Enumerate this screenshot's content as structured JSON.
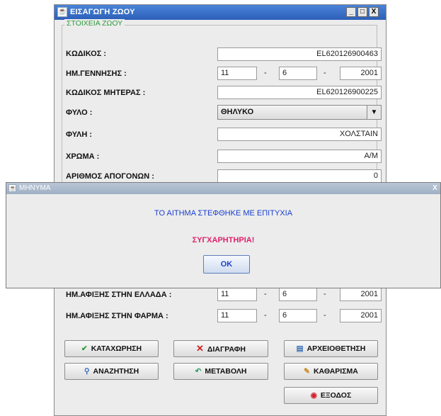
{
  "main_window": {
    "title": "ΕΙΣΑΓΩΓΗ ΖΩΟΥ",
    "window_buttons": [
      "_",
      "□",
      "X"
    ],
    "legend": "ΣΤΟΙΧΕΙΑ ΖΩΟΥ",
    "fields": {
      "code_label": "ΚΩΔΙΚΟΣ :",
      "code_value": "EL620126900463",
      "birth_label": "ΗΜ.ΓΕΝΝΗΣΗΣ :",
      "birth_day": "11",
      "birth_month": "6",
      "birth_year": "2001",
      "mother_label": "ΚΩΔΙΚΟΣ ΜΗΤΕΡΑΣ :",
      "mother_value": "EL620126900225",
      "sex_label": "ΦΥΛΟ :",
      "sex_value": "ΘΗΛΥΚΟ",
      "breed_label": "ΦΥΛΗ :",
      "breed_value": "ΧΟΛΣΤΑΙΝ",
      "color_label": "ΧΡΩΜΑ :",
      "color_value": "Α/Μ",
      "offspring_label": "ΑΡΙΘΜΟΣ ΑΠΟΓΟΝΩΝ :",
      "offspring_value": "0",
      "arrival_gr_label": "ΗΜ.ΑΦΙΞΗΣ ΣΤΗΝ ΕΛΛΑΔΑ :",
      "arrival_gr_day": "11",
      "arrival_gr_month": "6",
      "arrival_gr_year": "2001",
      "arrival_farm_label": "ΗΜ.ΑΦΙΞΗΣ ΣΤΗΝ ΦΑΡΜΑ :",
      "arrival_farm_day": "11",
      "arrival_farm_month": "6",
      "arrival_farm_year": "2001",
      "dash": "-"
    },
    "buttons": {
      "register": "ΚΑΤΑΧΩΡΗΣΗ",
      "delete": "ΔΙΑΓΡΑΦΗ",
      "archive": "ΑΡΧΕΙΟΘΕΤΗΣΗ",
      "search": "ΑΝΑΖΗΤΗΣΗ",
      "modify": "ΜΕΤΑΒΟΛΗ",
      "clear": "ΚΑΘΑΡΙΣΜΑ",
      "exit": "ΕΞΟΔΟΣ"
    },
    "icons": {
      "register": "checkmark-icon",
      "delete": "x-icon",
      "archive": "folder-icon",
      "search": "magnifier-icon",
      "modify": "undo-arrow-icon",
      "clear": "broom-icon",
      "exit": "exit-icon"
    }
  },
  "dialog": {
    "title": "ΜΗΝΥΜΑ",
    "message_line1": "ΤΟ ΑΙΤΗΜΑ ΣΤΕΦΘΗΚΕ ΜΕ ΕΠΙΤΥΧΙΑ",
    "message_line2": "ΣΥΓΧΑΡΗΤΗΡΙΑ!",
    "ok_label": "OK",
    "close": "X"
  },
  "colors": {
    "title_bar": "#2c5fb8",
    "legend": "#2e9a3a",
    "message_blue": "#1a3fd0",
    "message_pink": "#e0206a"
  }
}
